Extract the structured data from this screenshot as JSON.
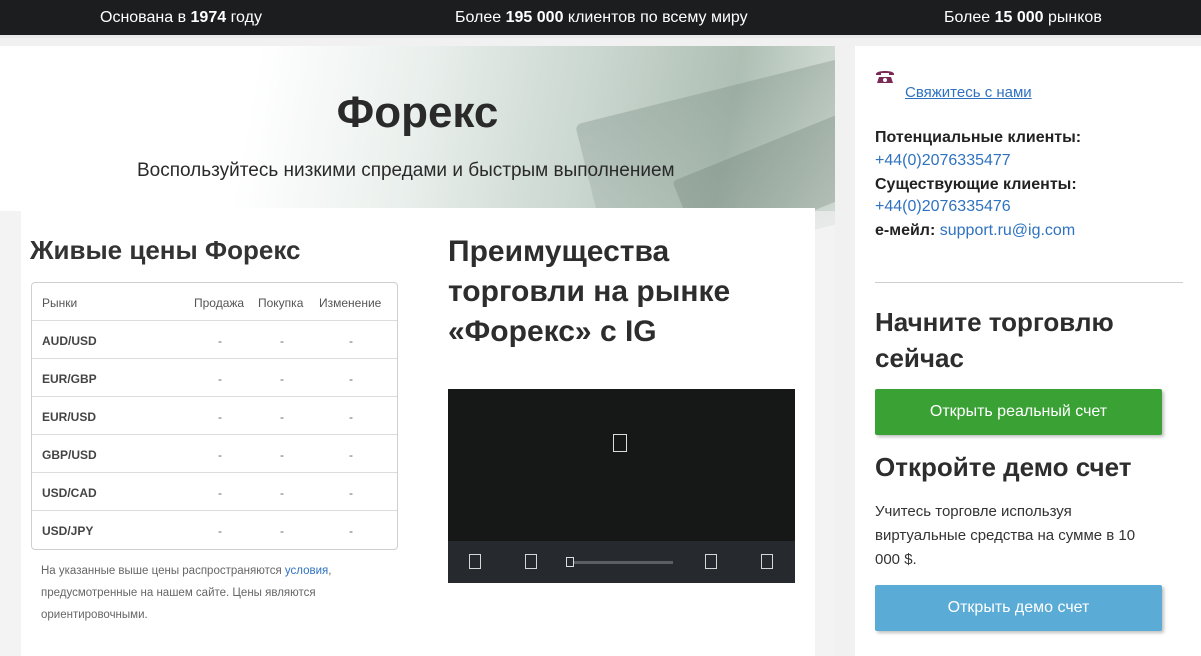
{
  "topbar": {
    "fact1_prefix": "Основана в ",
    "fact1_bold": "1974",
    "fact1_suffix": " году",
    "fact2_prefix": "Более ",
    "fact2_bold": "195 000",
    "fact2_suffix": " клиентов по всему миру",
    "fact3_prefix": "Более ",
    "fact3_bold": "15 000",
    "fact3_suffix": " рынков"
  },
  "hero": {
    "title": "Форекс",
    "subtitle": "Воспользуйтесь низкими спредами и быстрым выполнением"
  },
  "prices": {
    "title": "Живые цены Форекс",
    "columns": [
      "Рынки",
      "Продажа",
      "Покупка",
      "Изменение"
    ],
    "rows": [
      {
        "market": "AUD/USD",
        "sell": "-",
        "buy": "-",
        "change": "-"
      },
      {
        "market": "EUR/GBP",
        "sell": "-",
        "buy": "-",
        "change": "-"
      },
      {
        "market": "EUR/USD",
        "sell": "-",
        "buy": "-",
        "change": "-"
      },
      {
        "market": "GBP/USD",
        "sell": "-",
        "buy": "-",
        "change": "-"
      },
      {
        "market": "USD/CAD",
        "sell": "-",
        "buy": "-",
        "change": "-"
      },
      {
        "market": "USD/JPY",
        "sell": "-",
        "buy": "-",
        "change": "-"
      }
    ],
    "disclaimer_before": "На указанные выше цены распространяются ",
    "disclaimer_link": "условия",
    "disclaimer_after": ", предусмотренные на нашем сайте. Цены являются ориентировочными."
  },
  "advantages": {
    "title": "Преимущества торговли на рынке «Форекс» с IG"
  },
  "video": {
    "play_icon": "play-icon",
    "controls": [
      "play-pause-icon",
      "volume-icon",
      "settings-icon",
      "fullscreen-icon"
    ]
  },
  "sidebar": {
    "contact_icon": "phone-icon",
    "contact_link": "Свяжитесь с нами",
    "potential_label": "Потенциальные клиенты:",
    "potential_phone": "+44(0)2076335477",
    "existing_label": "Существующие клиенты:",
    "existing_phone": "+44(0)2076335476",
    "email_label": "е-мейл:",
    "email": "support.ru@ig.com",
    "start_title": "Начните торговлю сейчас",
    "real_button": "Открыть реальный счет",
    "demo_title": "Откройте демо счет",
    "demo_text": "Учитесь торговле используя виртуальные средства на сумме в 10 000 $.",
    "demo_button": "Открыть демо счет"
  },
  "colors": {
    "topbar_bg": "#1c1d1f",
    "link": "#2f72c0",
    "real_button": "#3aa235",
    "demo_button": "#5aabd6",
    "phone_icon": "#7a2a55"
  }
}
